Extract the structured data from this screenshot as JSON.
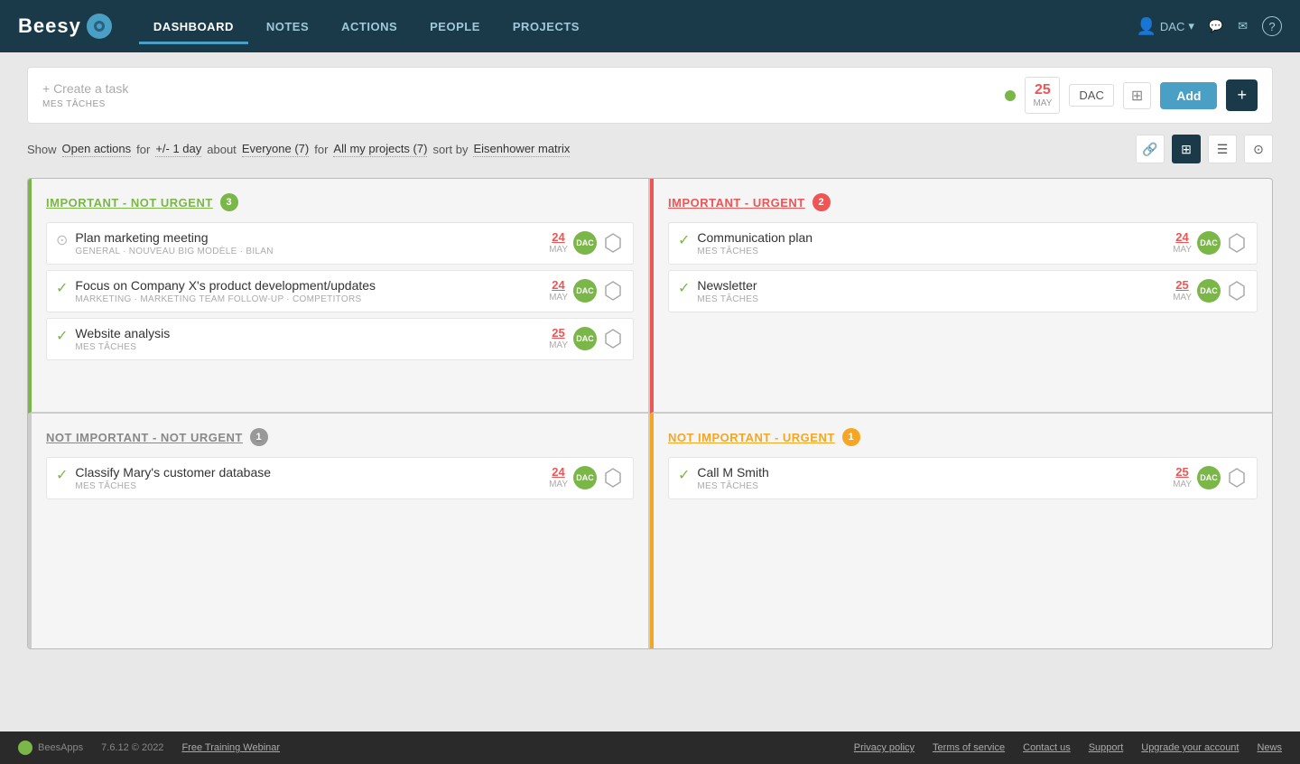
{
  "navbar": {
    "logo_text": "Beesy",
    "links": [
      {
        "label": "DASHBOARD",
        "active": true
      },
      {
        "label": "NOTES",
        "active": false
      },
      {
        "label": "ACTIONS",
        "active": false
      },
      {
        "label": "PEOPLE",
        "active": false
      },
      {
        "label": "PROJECTS",
        "active": false
      }
    ],
    "user": "DAC",
    "icons": {
      "chat": "💬",
      "mail": "✉",
      "help": "?"
    }
  },
  "task_bar": {
    "placeholder": "+ Create a task",
    "label": "MES TÂCHES",
    "date_day": "25",
    "date_month": "MAY",
    "dac": "DAC",
    "add_label": "Add"
  },
  "filters": {
    "show_label": "Show",
    "open_actions": "Open actions",
    "for1": "for",
    "range": "+/- 1 day",
    "about": "about",
    "everyone": "Everyone (7)",
    "for2": "for",
    "projects": "All my projects (7)",
    "sort_by": "sort by",
    "sort": "Eisenhower matrix"
  },
  "quadrants": [
    {
      "id": "important-not-urgent",
      "title": "IMPORTANT - NOT URGENT",
      "color": "green",
      "count": 3,
      "tasks": [
        {
          "name": "Plan marketing meeting",
          "sub": "GENERAL · NOUVEAU BIG MODÈLE · BILAN",
          "date_day": "24",
          "date_month": "MAY",
          "avatar": "DAC",
          "checked": false
        },
        {
          "name": "Focus on Company X's product development/updates",
          "sub": "MARKETING · MARKETING TEAM FOLLOW-UP · COMPETITORS",
          "date_day": "24",
          "date_month": "MAY",
          "avatar": "DAC",
          "checked": false
        },
        {
          "name": "Website analysis",
          "sub": "MES TÂCHES",
          "date_day": "25",
          "date_month": "MAY",
          "avatar": "DAC",
          "checked": false
        }
      ]
    },
    {
      "id": "important-urgent",
      "title": "IMPORTANT - URGENT",
      "color": "red",
      "count": 2,
      "tasks": [
        {
          "name": "Communication plan",
          "sub": "MES TÂCHES",
          "date_day": "24",
          "date_month": "MAY",
          "avatar": "DAC",
          "checked": false
        },
        {
          "name": "Newsletter",
          "sub": "MES TÂCHES",
          "date_day": "25",
          "date_month": "MAY",
          "avatar": "DAC",
          "checked": false
        }
      ]
    },
    {
      "id": "not-important-not-urgent",
      "title": "NOT IMPORTANT - NOT URGENT",
      "color": "gray",
      "count": 1,
      "tasks": [
        {
          "name": "Classify Mary's customer database",
          "sub": "MES TÂCHES",
          "date_day": "24",
          "date_month": "MAY",
          "avatar": "DAC",
          "checked": false
        }
      ]
    },
    {
      "id": "not-important-urgent",
      "title": "NOT IMPORTANT - URGENT",
      "color": "orange",
      "count": 1,
      "tasks": [
        {
          "name": "Call M Smith",
          "sub": "MES TÂCHES",
          "date_day": "25",
          "date_month": "MAY",
          "avatar": "DAC",
          "checked": false
        }
      ]
    }
  ],
  "footer": {
    "logo": "BeesApps",
    "version": "7.6.12 © 2022",
    "webinar": "Free Training Webinar",
    "links": [
      "Privacy policy",
      "Terms of service",
      "Contact us",
      "Support",
      "Upgrade your account",
      "News"
    ]
  }
}
